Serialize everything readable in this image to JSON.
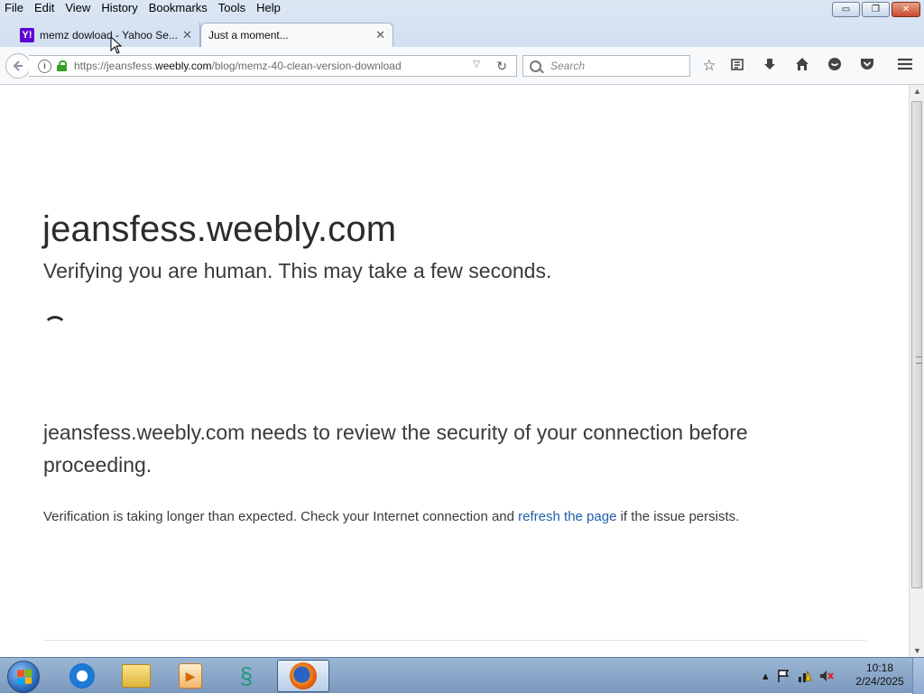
{
  "menubar": {
    "items": [
      "File",
      "Edit",
      "View",
      "History",
      "Bookmarks",
      "Tools",
      "Help"
    ]
  },
  "window_controls": {
    "minimize": "▭",
    "restore": "❐",
    "close": "✕"
  },
  "tabs": [
    {
      "title": "memz dowload - Yahoo Se...",
      "favicon": "Y!",
      "favicon_icon": "yahoo-icon",
      "active": false
    },
    {
      "title": "Just a moment...",
      "active": true
    }
  ],
  "newtab_glyph": "+",
  "navbar": {
    "url_prefix": "https://jeansfess.",
    "url_host": "weebly.com",
    "url_path": "/blog/memz-40-clean-version-download",
    "search_placeholder": "Search"
  },
  "toolbar_icons": [
    "star-icon",
    "reading-list-icon",
    "download-icon",
    "home-icon",
    "chat-icon",
    "pocket-icon",
    "hamburger-menu-icon"
  ],
  "page": {
    "heading": "jeansfess.weebly.com",
    "subheading": "Verifying you are human. This may take a few seconds.",
    "notice": "jeansfess.weebly.com needs to review the security of your connection before proceeding.",
    "detail_before": "Verification is taking longer than expected. Check your Internet connection and ",
    "detail_link": "refresh the page",
    "detail_after": " if the issue persists.",
    "link_color": "#1f5fa8"
  },
  "taskbar": {
    "apps": [
      "internet-explorer-icon",
      "file-explorer-icon",
      "media-player-icon",
      "dragon-app-icon",
      "firefox-icon"
    ],
    "active_app": "firefox-icon",
    "clock_time": "10:18",
    "clock_date": "2/24/2025"
  }
}
